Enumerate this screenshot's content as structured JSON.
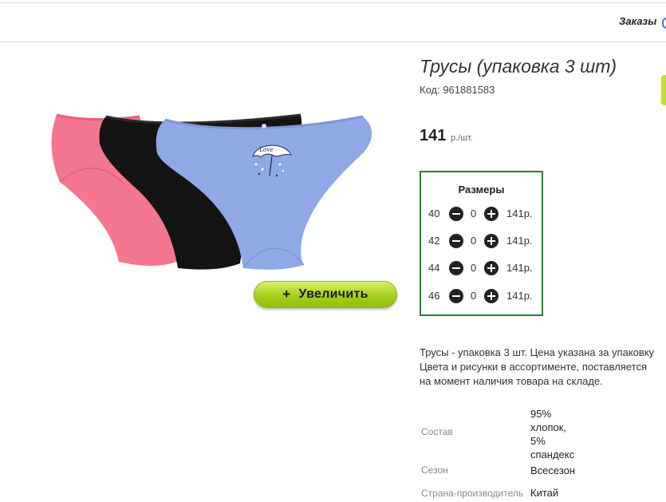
{
  "header": {
    "orders_label": "Заказы"
  },
  "product": {
    "title": "Трусы (упаковка 3 шт)",
    "code_text": "Код: 961881583",
    "price": "141",
    "price_unit": "р./шт.",
    "zoom_button": {
      "icon": "+",
      "label": "Увеличить"
    },
    "image_print_text": "Love"
  },
  "sizes": {
    "title": "Размеры",
    "rows": [
      {
        "size": "40",
        "qty": "0",
        "price": "141р."
      },
      {
        "size": "42",
        "qty": "0",
        "price": "141р."
      },
      {
        "size": "44",
        "qty": "0",
        "price": "141р."
      },
      {
        "size": "46",
        "qty": "0",
        "price": "141р."
      }
    ]
  },
  "description": {
    "lines": [
      "Трусы - упаковка 3 шт. Цена указана за упаковку",
      "Цвета и рисунки в ассортименте, поставляется",
      "на момент наличия товара на складе."
    ]
  },
  "properties": [
    {
      "label": "Состав",
      "value_lines": [
        "95%",
        "хлопок,",
        "5%",
        "спандекс"
      ]
    },
    {
      "label": "Сезон",
      "value_lines": [
        "Всесезон"
      ]
    },
    {
      "label": "Страна-производитель",
      "value_lines": [
        "Китай"
      ]
    }
  ],
  "colors": {
    "sizes_border": "#1a8a1a",
    "zoom_button": "#a6cf1b",
    "pink": "#f4768f",
    "black": "#141414",
    "blue": "#8fa9e6"
  }
}
